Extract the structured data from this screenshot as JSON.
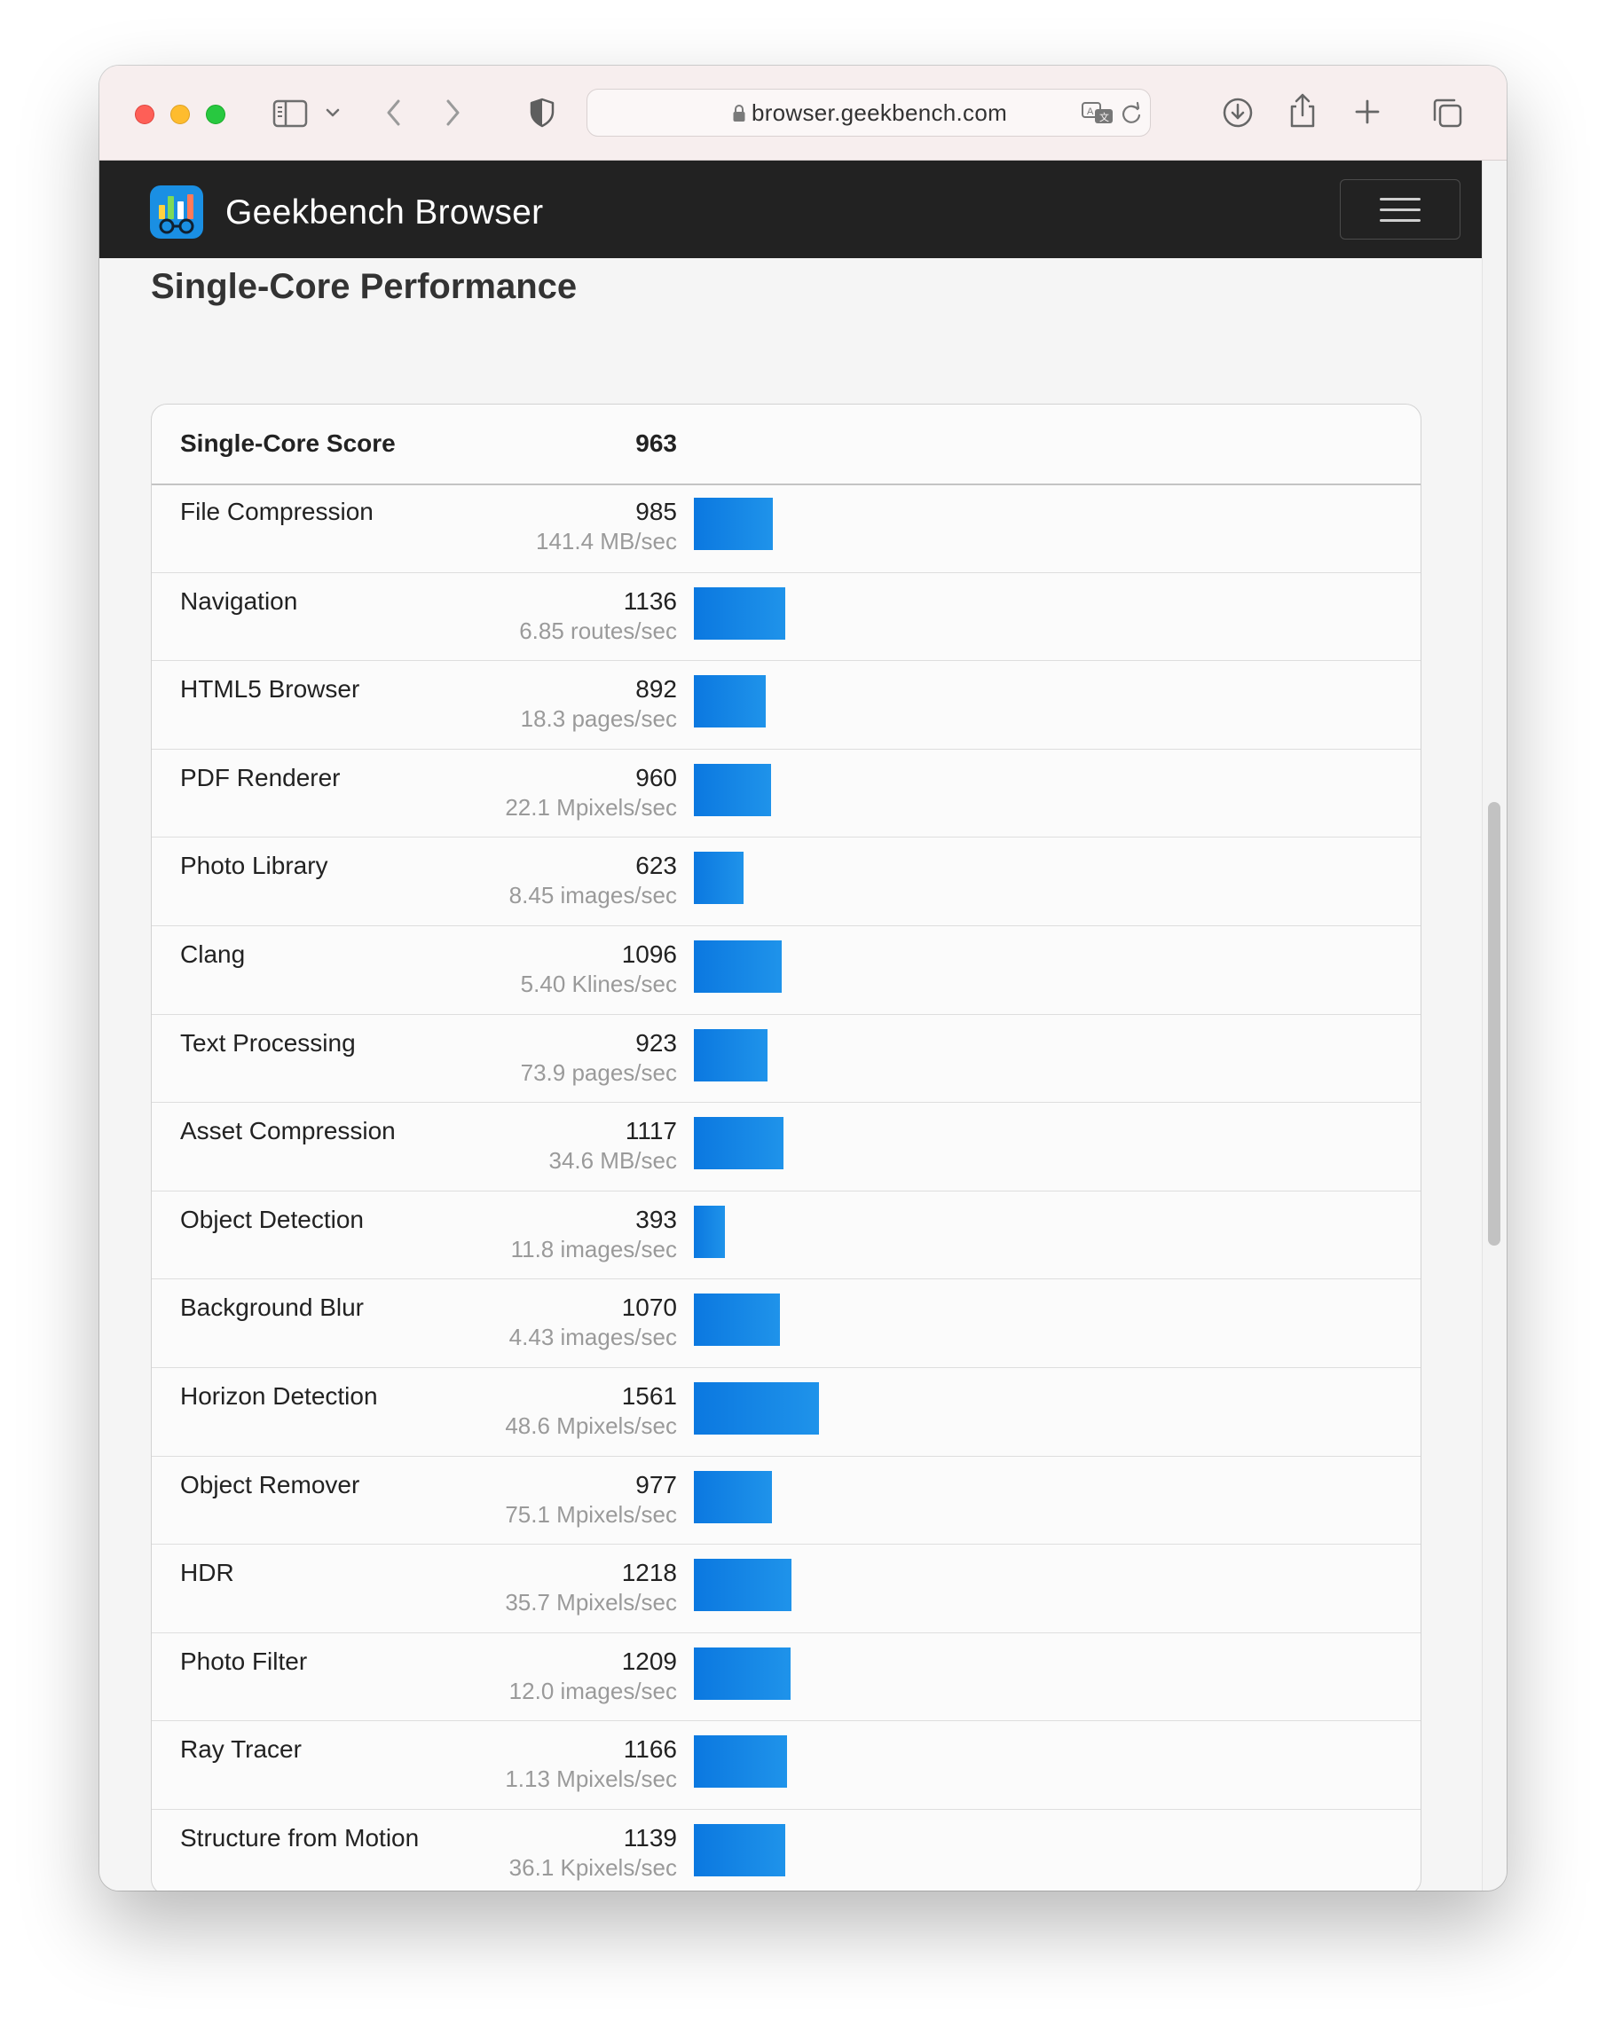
{
  "browser": {
    "url": "browser.geekbench.com",
    "icons": [
      "sidebar-icon",
      "chevron-down-icon",
      "back-icon",
      "forward-icon",
      "shield-icon",
      "lock-icon",
      "translate-icon",
      "reload-icon",
      "download-icon",
      "share-icon",
      "new-tab-icon",
      "tabs-overview-icon"
    ],
    "traffic_lights": {
      "close": "#fe5f57",
      "minimize": "#febc2e",
      "zoom": "#28c840"
    }
  },
  "site": {
    "brand": "Geekbench Browser",
    "menu_icon": "hamburger-menu-icon"
  },
  "section_title": "Single-Core Performance",
  "summary": {
    "label": "Single-Core Score",
    "score": "963"
  },
  "colors": {
    "bar": "#0b78e0",
    "navbar": "#222222"
  },
  "benchmarks": [
    {
      "name": "File Compression",
      "score": "985",
      "rate": "141.4 MB/sec",
      "bar_value": 985
    },
    {
      "name": "Navigation",
      "score": "1136",
      "rate": "6.85 routes/sec",
      "bar_value": 1136
    },
    {
      "name": "HTML5 Browser",
      "score": "892",
      "rate": "18.3 pages/sec",
      "bar_value": 892
    },
    {
      "name": "PDF Renderer",
      "score": "960",
      "rate": "22.1 Mpixels/sec",
      "bar_value": 960
    },
    {
      "name": "Photo Library",
      "score": "623",
      "rate": "8.45 images/sec",
      "bar_value": 623
    },
    {
      "name": "Clang",
      "score": "1096",
      "rate": "5.40 Klines/sec",
      "bar_value": 1096
    },
    {
      "name": "Text Processing",
      "score": "923",
      "rate": "73.9 pages/sec",
      "bar_value": 923
    },
    {
      "name": "Asset Compression",
      "score": "1117",
      "rate": "34.6 MB/sec",
      "bar_value": 1117
    },
    {
      "name": "Object Detection",
      "score": "393",
      "rate": "11.8 images/sec",
      "bar_value": 393
    },
    {
      "name": "Background Blur",
      "score": "1070",
      "rate": "4.43 images/sec",
      "bar_value": 1070
    },
    {
      "name": "Horizon Detection",
      "score": "1561",
      "rate": "48.6 Mpixels/sec",
      "bar_value": 1561
    },
    {
      "name": "Object Remover",
      "score": "977",
      "rate": "75.1 Mpixels/sec",
      "bar_value": 977
    },
    {
      "name": "HDR",
      "score": "1218",
      "rate": "35.7 Mpixels/sec",
      "bar_value": 1218
    },
    {
      "name": "Photo Filter",
      "score": "1209",
      "rate": "12.0 images/sec",
      "bar_value": 1209
    },
    {
      "name": "Ray Tracer",
      "score": "1166",
      "rate": "1.13 Mpixels/sec",
      "bar_value": 1166
    },
    {
      "name": "Structure from Motion",
      "score": "1139",
      "rate": "36.1 Kpixels/sec",
      "bar_value": 1139
    }
  ]
}
